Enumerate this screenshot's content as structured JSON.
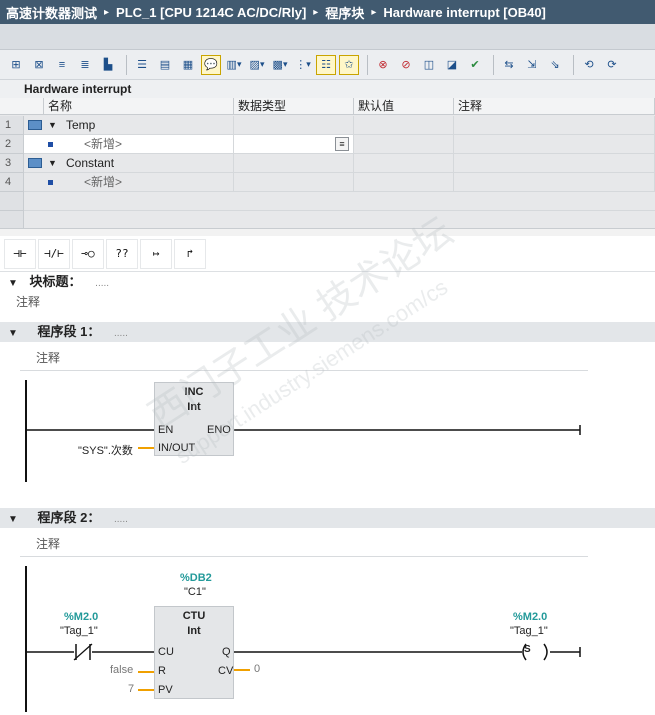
{
  "title_bar": {
    "project": "高速计数器测试",
    "device": "PLC_1 [CPU 1214C AC/DC/Rly]",
    "folder": "程序块",
    "block": "Hardware interrupt [OB40]",
    "separator": "▸"
  },
  "block_name": "Hardware interrupt",
  "interface_table": {
    "columns": [
      "名称",
      "数据类型",
      "默认值",
      "注释"
    ],
    "rows": [
      {
        "num": "1",
        "name": "Temp",
        "kind": "section"
      },
      {
        "num": "2",
        "name": "<新增>",
        "kind": "add"
      },
      {
        "num": "3",
        "name": "Constant",
        "kind": "section"
      },
      {
        "num": "4",
        "name": "<新增>",
        "kind": "add"
      }
    ]
  },
  "ladder_palette": [
    "⊣⊢",
    "⊣/⊢",
    "⊸○",
    "??",
    "↦",
    "↱"
  ],
  "block_title": {
    "label": "块标题：",
    "dots": ".....",
    "comment": "注释"
  },
  "networks": [
    {
      "title": "程序段 1：",
      "dots": ".....",
      "comment": "注释",
      "instruction": {
        "name": "INC",
        "type": "Int",
        "pin_en": "EN",
        "pin_eno": "ENO",
        "pin_inout": "IN/OUT",
        "operand_inout": "\"SYS\".次数"
      }
    },
    {
      "title": "程序段 2：",
      "dots": ".....",
      "comment": "注释",
      "contact": {
        "address": "%M2.0",
        "tag": "\"Tag_1\""
      },
      "counter": {
        "db_address": "%DB2",
        "db_name": "\"C1\"",
        "name": "CTU",
        "type": "Int",
        "pin_cu": "CU",
        "pin_r": "R",
        "pin_pv": "PV",
        "pin_q": "Q",
        "pin_cv": "CV",
        "operand_r": "false",
        "operand_pv": "7",
        "operand_cv": "0"
      },
      "coil": {
        "address": "%M2.0",
        "tag": "\"Tag_1\"",
        "symbol": "( S )"
      }
    }
  ],
  "watermark": {
    "line1": "西门子工业  技术论坛",
    "line2": "support.industry.siemens.com/cs"
  },
  "colors": {
    "title_bg": "#415a70",
    "teal_address": "#239a9a",
    "connection_orange": "#f0a000"
  }
}
